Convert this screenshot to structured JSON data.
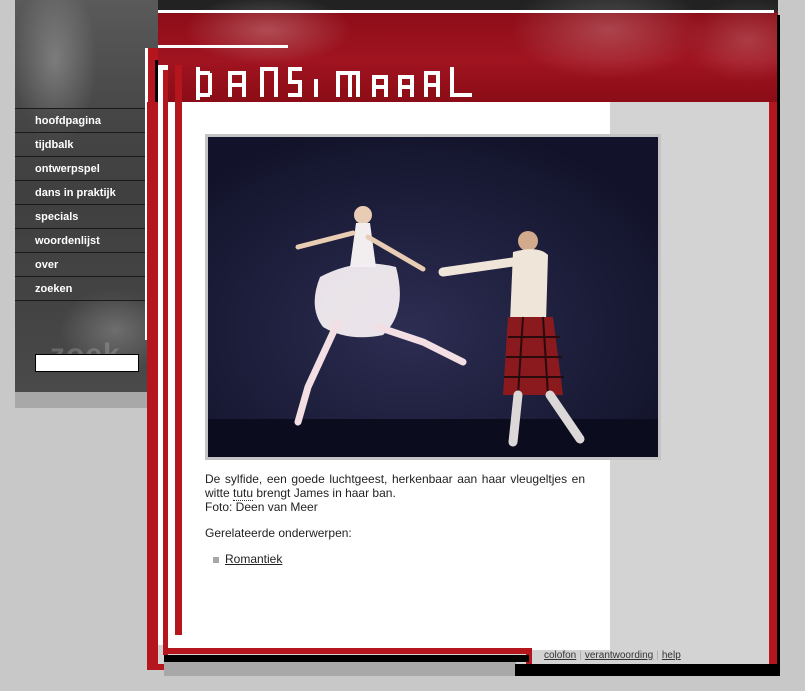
{
  "site": {
    "logo_text": "dans in beeld"
  },
  "nav": {
    "items": [
      {
        "label": "hoofdpagina"
      },
      {
        "label": "tijdbalk"
      },
      {
        "label": "ontwerpspel"
      },
      {
        "label": "dans in praktijk"
      },
      {
        "label": "specials"
      },
      {
        "label": "woordenlijst"
      },
      {
        "label": "over"
      },
      {
        "label": "zoeken"
      }
    ]
  },
  "search": {
    "value": "",
    "ghost_label": "zoek"
  },
  "photo": {
    "alt": "De sylfide, een goede luchtgeest, herkenbaar aan haar vleugeltjes en witte tutu brengt James in haar ban."
  },
  "caption": {
    "part1": "De sylfide, een goede luchtgeest, herkenbaar aan haar vleugeltjes en witte ",
    "abbr": "tutu",
    "part2": " brengt James in haar ban.",
    "credit": "Foto: Deen van Meer"
  },
  "related": {
    "heading": "Gerelateerde onderwerpen:",
    "links": [
      {
        "label": "Romantiek"
      }
    ]
  },
  "footer": {
    "links": [
      {
        "label": "colofon"
      },
      {
        "label": "verantwoording"
      },
      {
        "label": "help"
      }
    ]
  },
  "colors": {
    "accent_red": "#b5161e",
    "header_red": "#a01420",
    "sidebar_gray": "#4a4a4a",
    "page_gray": "#c8c8c8"
  }
}
